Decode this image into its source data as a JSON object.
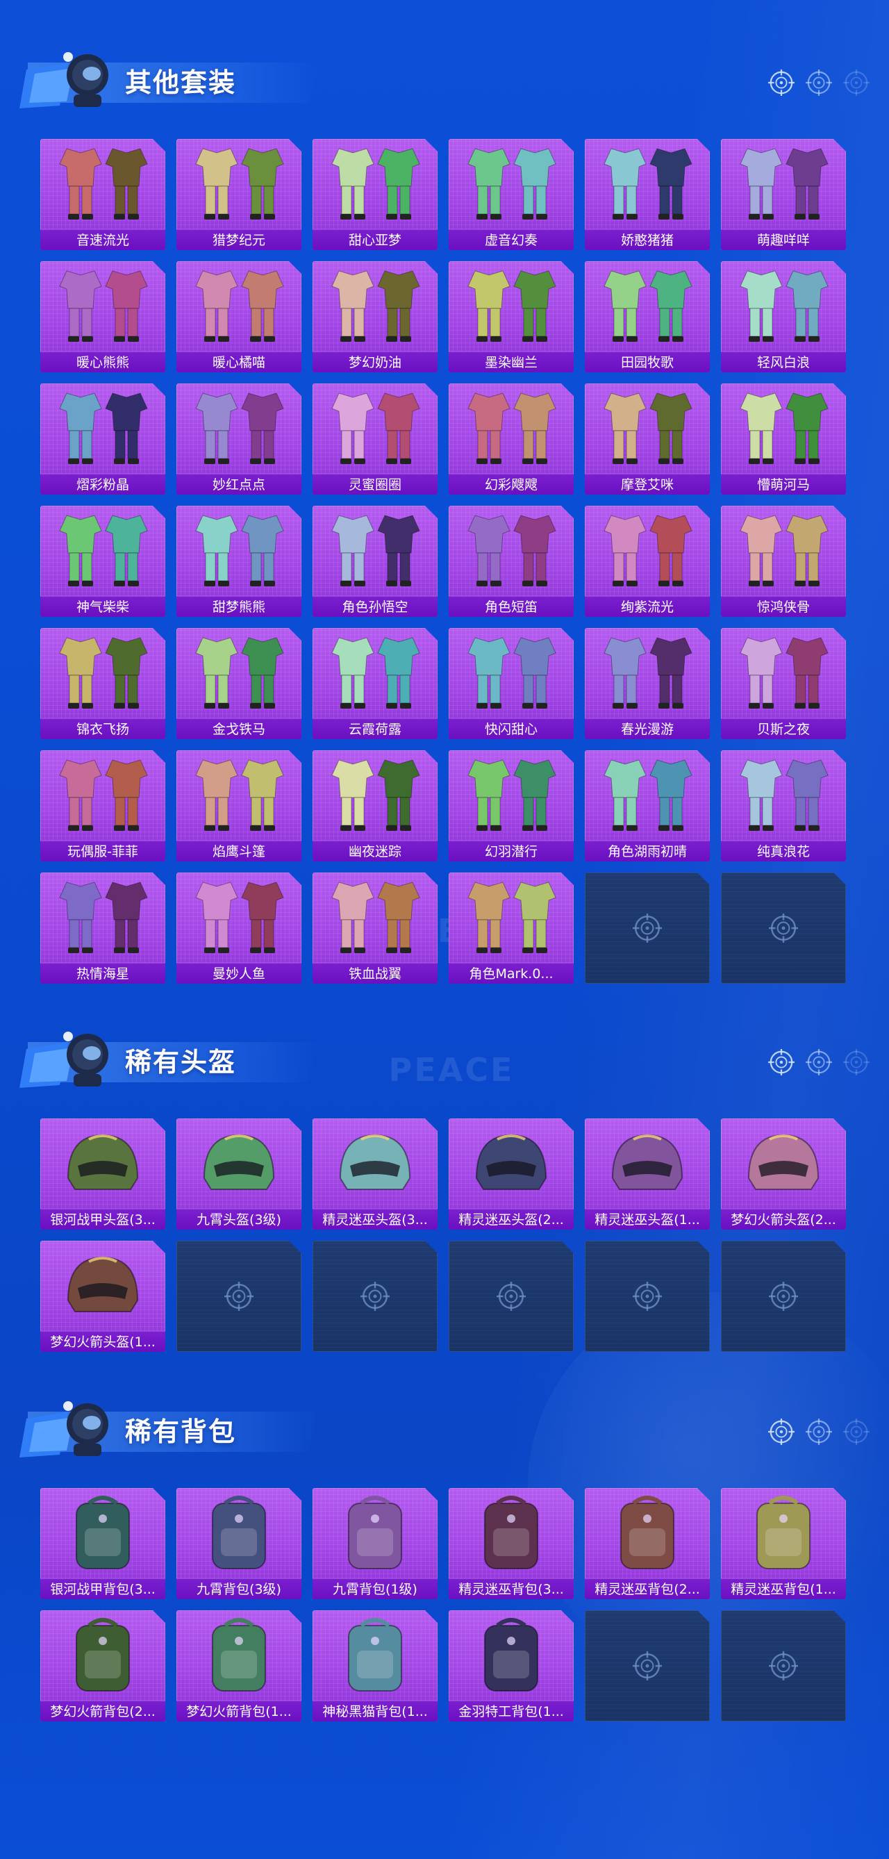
{
  "colors": {
    "background": "#0b4ed6",
    "tile_purple": "#a246e6",
    "label_purple": "#6a10c0",
    "empty_tile": "#1e3a70"
  },
  "icons": {
    "header_logo": "astronaut-mascot-icon",
    "target": "crosshair-target-icon",
    "outfit": "outfit-icon",
    "helmet": "helmet-icon",
    "backpack": "backpack-icon"
  },
  "background_watermark": "GAME FOR PEACE",
  "sections": [
    {
      "title": "其他套装",
      "item_icon": "outfit",
      "items": [
        "音速流光",
        "猎梦纪元",
        "甜心亚梦",
        "虚音幻奏",
        "娇憨猪猪",
        "萌趣咩咩",
        "暖心熊熊",
        "暖心橘喵",
        "梦幻奶油",
        "墨染幽兰",
        "田园牧歌",
        "轻风白浪",
        "熠彩粉晶",
        "妙红点点",
        "灵蜜圈圈",
        "幻彩飕飕",
        "摩登艾咪",
        "懵萌河马",
        "神气柴柴",
        "甜梦熊熊",
        "角色孙悟空",
        "角色短笛",
        "绚紫流光",
        "惊鸿侠骨",
        "锦衣飞扬",
        "金戈铁马",
        "云霞荷露",
        "快闪甜心",
        "春光漫游",
        "贝斯之夜",
        "玩偶服-菲菲",
        "焰鹰斗篷",
        "幽夜迷踪",
        "幻羽潜行",
        "角色湖雨初晴",
        "纯真浪花",
        "热情海星",
        "曼妙人鱼",
        "铁血战翼",
        "角色Mark.0...",
        "",
        ""
      ]
    },
    {
      "title": "稀有头盔",
      "item_icon": "helmet",
      "items": [
        "银河战甲头盔(3...",
        "九霄头盔(3级)",
        "精灵迷巫头盔(3...",
        "精灵迷巫头盔(2...",
        "精灵迷巫头盔(1...",
        "梦幻火箭头盔(2...",
        "梦幻火箭头盔(1...",
        "",
        "",
        "",
        "",
        ""
      ]
    },
    {
      "title": "稀有背包",
      "item_icon": "backpack",
      "items": [
        "银河战甲背包(3...",
        "九霄背包(3级)",
        "九霄背包(1级)",
        "精灵迷巫背包(3...",
        "精灵迷巫背包(2...",
        "精灵迷巫背包(1...",
        "梦幻火箭背包(2...",
        "梦幻火箭背包(1...",
        "神秘黑猫背包(1...",
        "金羽特工背包(1...",
        "",
        ""
      ]
    }
  ]
}
